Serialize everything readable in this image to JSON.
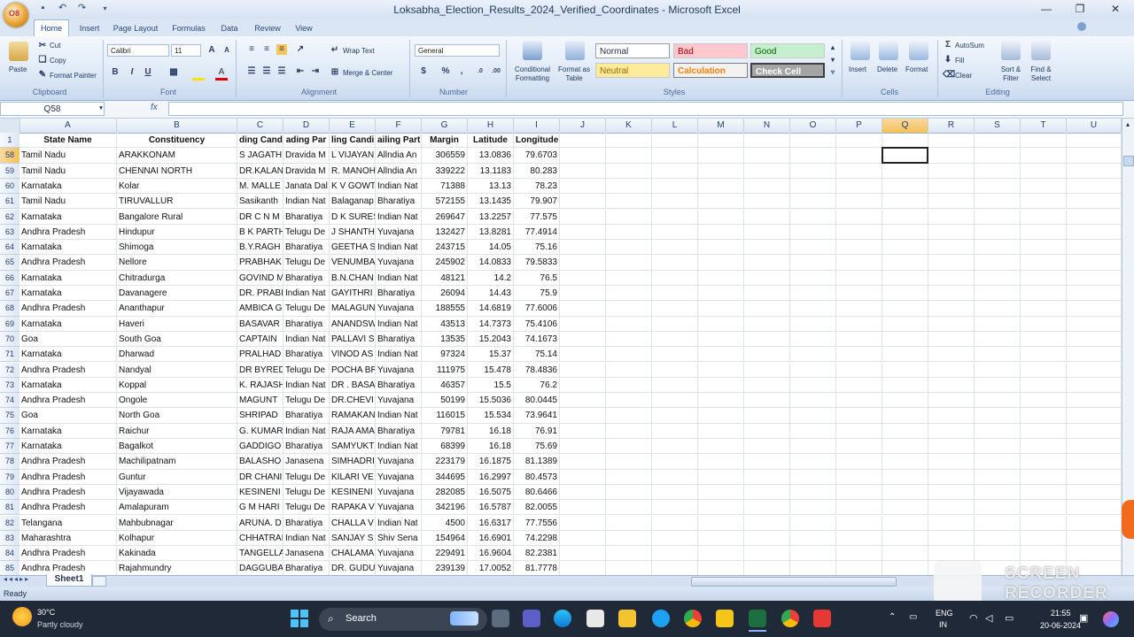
{
  "window": {
    "title": "Loksabha_Election_Results_2024_Verified_Coordinates - Microsoft Excel",
    "office_button": "O8",
    "quick_access": [
      "save-icon",
      "undo-icon",
      "redo-icon",
      "customize-icon"
    ]
  },
  "ribbon": {
    "tabs": [
      "Home",
      "Insert",
      "Page Layout",
      "Formulas",
      "Data",
      "Review",
      "View"
    ],
    "active_tab": "Home",
    "clipboard": {
      "paste": "Paste",
      "cut": "Cut",
      "copy": "Copy",
      "format_painter": "Format Painter",
      "label": "Clipboard"
    },
    "font": {
      "name": "Calibri",
      "size": "11",
      "bold": "B",
      "italic": "I",
      "underline": "U",
      "label": "Font"
    },
    "alignment": {
      "wrap_text": "Wrap Text",
      "merge_center": "Merge & Center",
      "label": "Alignment"
    },
    "number": {
      "format": "General",
      "percent": "%",
      "comma": ",",
      "label": "Number"
    },
    "styles": {
      "conditional": "Conditional Formatting",
      "format_as_table": "Format as Table",
      "normal": "Normal",
      "bad": "Bad",
      "good": "Good",
      "neutral": "Neutral",
      "calculation": "Calculation",
      "check_cell": "Check Cell",
      "label": "Styles"
    },
    "cells": {
      "insert": "Insert",
      "delete": "Delete",
      "format": "Format",
      "label": "Cells"
    },
    "editing": {
      "autosum": "AutoSum",
      "fill": "Fill",
      "clear": "Clear",
      "sort_filter": "Sort & Filter",
      "find_select": "Find & Select",
      "label": "Editing"
    }
  },
  "formula_bar": {
    "name_box": "Q58",
    "fx": "fx",
    "value": ""
  },
  "columns": [
    "A",
    "B",
    "C",
    "D",
    "E",
    "F",
    "G",
    "H",
    "I",
    "J",
    "K",
    "L",
    "M",
    "N",
    "O",
    "P",
    "Q",
    "R",
    "S",
    "T",
    "U"
  ],
  "selected_column": "Q",
  "header_row": {
    "row": "1",
    "cells": [
      "State Name",
      "Constituency",
      "ding Candi",
      "ading Par",
      "ling Candi",
      "ailing Part",
      "Margin",
      "Latitude",
      "Longitude"
    ]
  },
  "rows": [
    {
      "n": "58",
      "c": [
        "Tamil Nadu",
        "ARAKKONAM",
        "S JAGATHR",
        "Dravida M",
        "L VIJAYAN",
        "Allndia An",
        "306559",
        "13.0836",
        "79.6703"
      ]
    },
    {
      "n": "59",
      "c": [
        "Tamil Nadu",
        "CHENNAI NORTH",
        "DR.KALAN",
        "Dravida M",
        "R. MANOH",
        "Allndia An",
        "339222",
        "13.1183",
        "80.283"
      ]
    },
    {
      "n": "60",
      "c": [
        "Karnataka",
        "Kolar",
        "M. MALLE",
        "Janata Dal",
        "K V GOWT",
        "Indian Nat",
        "71388",
        "13.13",
        "78.23"
      ]
    },
    {
      "n": "61",
      "c": [
        "Tamil Nadu",
        "TIRUVALLUR",
        "Sasikanth",
        "Indian Nat",
        "Balaganap",
        "Bharatiya",
        "572155",
        "13.1435",
        "79.907"
      ]
    },
    {
      "n": "62",
      "c": [
        "Karnataka",
        "Bangalore Rural",
        "DR C N M",
        "Bharatiya",
        "D K SURES",
        "Indian Nat",
        "269647",
        "13.2257",
        "77.575"
      ]
    },
    {
      "n": "63",
      "c": [
        "Andhra Pradesh",
        "Hindupur",
        "B K PARTH",
        "Telugu De",
        "J SHANTH",
        "Yuvajana",
        "132427",
        "13.8281",
        "77.4914"
      ]
    },
    {
      "n": "64",
      "c": [
        "Karnataka",
        "Shimoga",
        "B.Y.RAGH",
        "Bharatiya",
        "GEETHA SI",
        "Indian Nat",
        "243715",
        "14.05",
        "75.16"
      ]
    },
    {
      "n": "65",
      "c": [
        "Andhra Pradesh",
        "Nellore",
        "PRABHAK",
        "Telugu De",
        "VENUMBA",
        "Yuvajana",
        "245902",
        "14.0833",
        "79.5833"
      ]
    },
    {
      "n": "66",
      "c": [
        "Karnataka",
        "Chitradurga",
        "GOVIND M",
        "Bharatiya",
        "B.N.CHAN",
        "Indian Nat",
        "48121",
        "14.2",
        "76.5"
      ]
    },
    {
      "n": "67",
      "c": [
        "Karnataka",
        "Davanagere",
        "DR. PRABI",
        "Indian Nat",
        "GAYITHRI",
        "Bharatiya",
        "26094",
        "14.43",
        "75.9"
      ]
    },
    {
      "n": "68",
      "c": [
        "Andhra Pradesh",
        "Ananthapur",
        "AMBICA G",
        "Telugu De",
        "MALAGUN",
        "Yuvajana",
        "188555",
        "14.6819",
        "77.6006"
      ]
    },
    {
      "n": "69",
      "c": [
        "Karnataka",
        "Haveri",
        "BASAVAR",
        "Bharatiya",
        "ANANDSW",
        "Indian Nat",
        "43513",
        "14.7373",
        "75.4106"
      ]
    },
    {
      "n": "70",
      "c": [
        "Goa",
        "South Goa",
        "CAPTAIN",
        "Indian Nat",
        "PALLAVI S",
        "Bharatiya",
        "13535",
        "15.2043",
        "74.1673"
      ]
    },
    {
      "n": "71",
      "c": [
        "Karnataka",
        "Dharwad",
        "PRALHAD",
        "Bharatiya",
        "VINOD AS",
        "Indian Nat",
        "97324",
        "15.37",
        "75.14"
      ]
    },
    {
      "n": "72",
      "c": [
        "Andhra Pradesh",
        "Nandyal",
        "DR BYRED",
        "Telugu De",
        "POCHA BR",
        "Yuvajana",
        "111975",
        "15.478",
        "78.4836"
      ]
    },
    {
      "n": "73",
      "c": [
        "Karnataka",
        "Koppal",
        "K. RAJASH",
        "Indian Nat",
        "DR . BASA",
        "Bharatiya",
        "46357",
        "15.5",
        "76.2"
      ]
    },
    {
      "n": "74",
      "c": [
        "Andhra Pradesh",
        "Ongole",
        "MAGUNT",
        "Telugu De",
        "DR.CHEVI",
        "Yuvajana",
        "50199",
        "15.5036",
        "80.0445"
      ]
    },
    {
      "n": "75",
      "c": [
        "Goa",
        "North Goa",
        "SHRIPAD",
        "Bharatiya",
        "RAMAKAN",
        "Indian Nat",
        "116015",
        "15.534",
        "73.9641"
      ]
    },
    {
      "n": "76",
      "c": [
        "Karnataka",
        "Raichur",
        "G. KUMAR",
        "Indian Nat",
        "RAJA AMA",
        "Bharatiya",
        "79781",
        "16.18",
        "76.91"
      ]
    },
    {
      "n": "77",
      "c": [
        "Karnataka",
        "Bagalkot",
        "GADDIGO",
        "Bharatiya",
        "SAMYUKT",
        "Indian Nat",
        "68399",
        "16.18",
        "75.69"
      ]
    },
    {
      "n": "78",
      "c": [
        "Andhra Pradesh",
        "Machilipatnam",
        "BALASHO",
        "Janasena",
        "SIMHADRI",
        "Yuvajana",
        "223179",
        "16.1875",
        "81.1389"
      ]
    },
    {
      "n": "79",
      "c": [
        "Andhra Pradesh",
        "Guntur",
        "DR CHANI",
        "Telugu De",
        "KILARI VE",
        "Yuvajana",
        "344695",
        "16.2997",
        "80.4573"
      ]
    },
    {
      "n": "80",
      "c": [
        "Andhra Pradesh",
        "Vijayawada",
        "KESINENI",
        "Telugu De",
        "KESINENI",
        "Yuvajana",
        "282085",
        "16.5075",
        "80.6466"
      ]
    },
    {
      "n": "81",
      "c": [
        "Andhra Pradesh",
        "Amalapuram",
        "G M HARI",
        "Telugu De",
        "RAPAKA V",
        "Yuvajana",
        "342196",
        "16.5787",
        "82.0055"
      ]
    },
    {
      "n": "82",
      "c": [
        "Telangana",
        "Mahbubnagar",
        "ARUNA. D",
        "Bharatiya",
        "CHALLA V",
        "Indian Nat",
        "4500",
        "16.6317",
        "77.7556"
      ]
    },
    {
      "n": "83",
      "c": [
        "Maharashtra",
        "Kolhapur",
        "CHHATRAI",
        "Indian Nat",
        "SANJAY S",
        "Shiv Sena",
        "154964",
        "16.6901",
        "74.2298"
      ]
    },
    {
      "n": "84",
      "c": [
        "Andhra Pradesh",
        "Kakinada",
        "TANGELLA",
        "Janasena",
        "CHALAMA",
        "Yuvajana",
        "229491",
        "16.9604",
        "82.2381"
      ]
    },
    {
      "n": "85",
      "c": [
        "Andhra Pradesh",
        "Rajahmundry",
        "DAGGUBA",
        "Bharatiya",
        "DR. GUDU",
        "Yuvajana",
        "239139",
        "17.0052",
        "81.7778"
      ]
    }
  ],
  "sheet_tabs": [
    "Sheet1"
  ],
  "status": "Ready",
  "taskbar": {
    "weather_temp": "30°C",
    "weather_desc": "Partly cloudy",
    "search": "Search",
    "lang1": "ENG",
    "lang2": "IN",
    "time": "21:55",
    "date": "20-06-2024"
  },
  "watermark": {
    "line1": "SCREEN",
    "line2": "RECORDER"
  }
}
